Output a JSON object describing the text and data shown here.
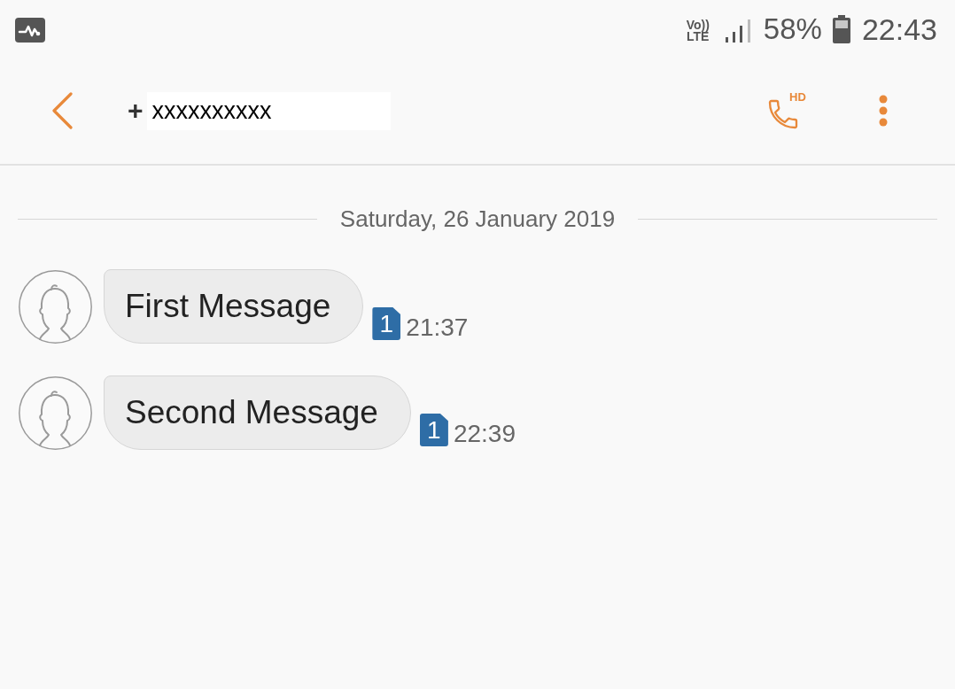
{
  "status_bar": {
    "volte": [
      "Vo))",
      "LTE"
    ],
    "battery": "58%",
    "time": "22:43"
  },
  "header": {
    "contact_prefix": "+",
    "contact_number": "xxxxxxxxxx",
    "call_label": "HD"
  },
  "date_separator": "Saturday, 26 January 2019",
  "messages": [
    {
      "text": "First Message",
      "sim": "1",
      "time": "21:37"
    },
    {
      "text": "Second Message",
      "sim": "1",
      "time": "22:39"
    }
  ]
}
